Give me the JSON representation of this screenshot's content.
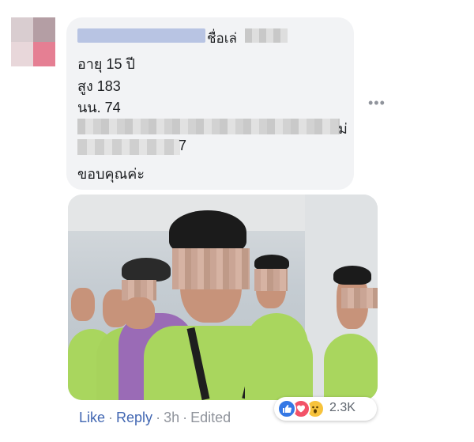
{
  "comment": {
    "name_suffix": "ชื่อเล่",
    "lines": [
      "อายุ 15 ปี",
      "สูง 183",
      "นน. 74",
      "ม่",
      "7",
      "ขอบคุณค่ะ"
    ]
  },
  "actions": {
    "like": "Like",
    "reply": "Reply",
    "time": "3h",
    "edited": "Edited",
    "sep": "·"
  },
  "reactions": {
    "count": "2.3K"
  },
  "colors": {
    "link": "#4267b2",
    "muted": "#90949c",
    "bubble": "#f2f3f5"
  }
}
